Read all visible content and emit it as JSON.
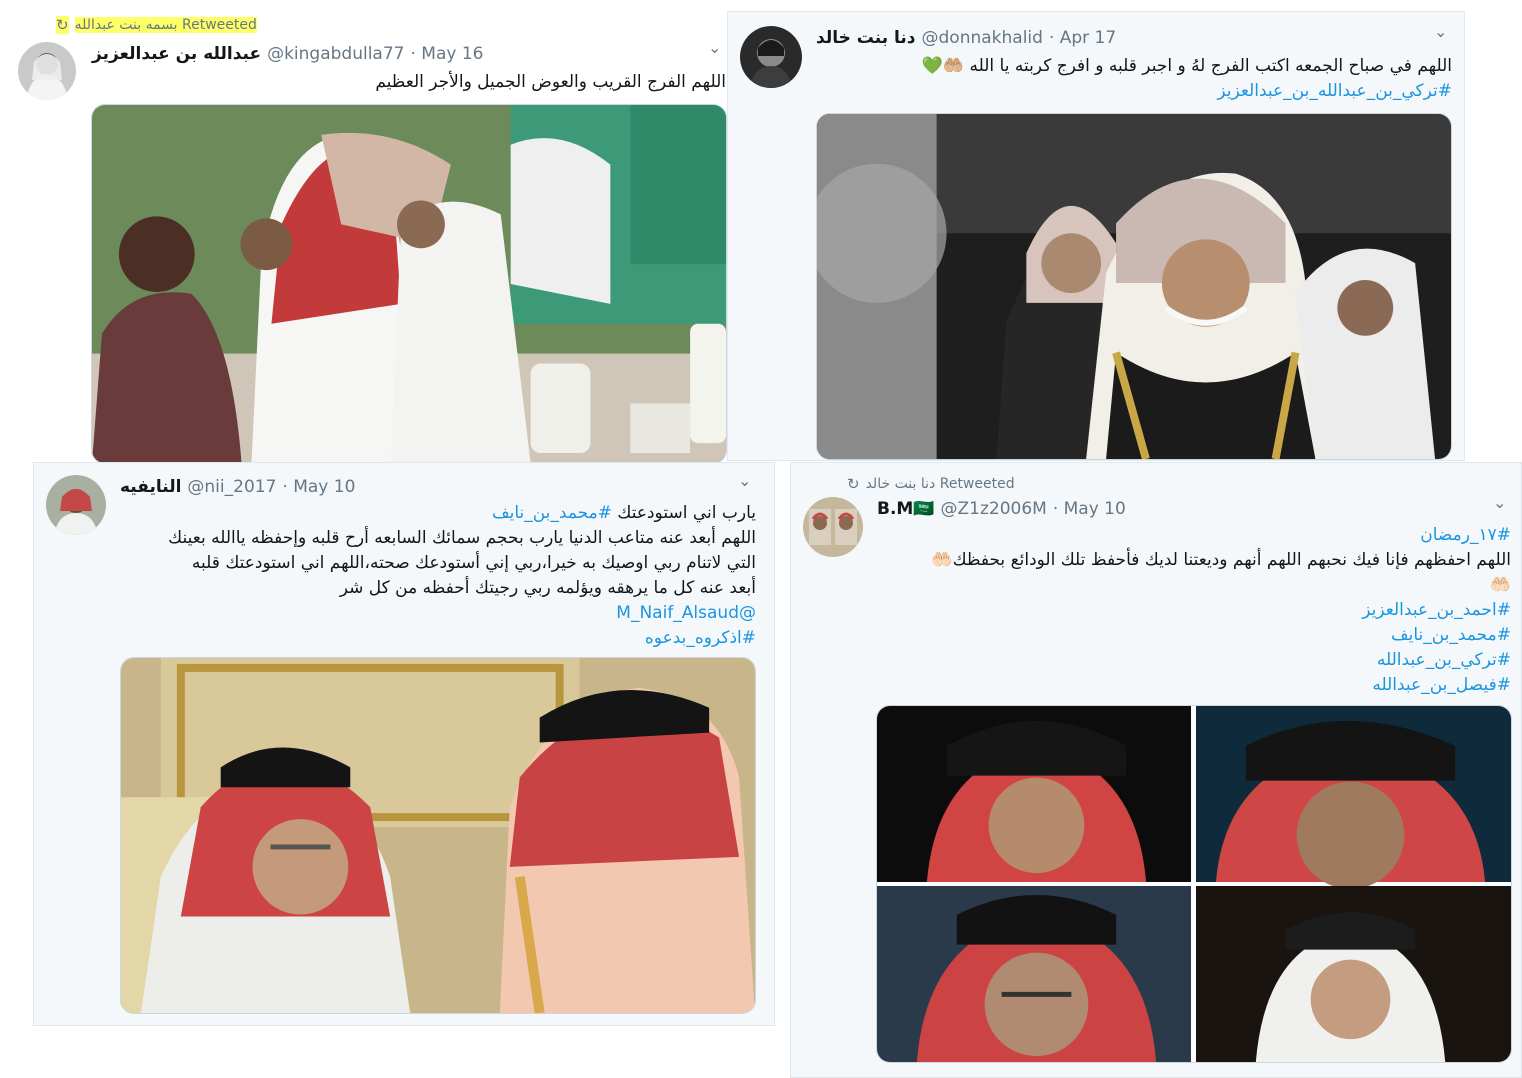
{
  "tweet1": {
    "retweet_context": "بسمه بنت عبدالله Retweeted",
    "name": "عبدالله بن عبدالعزيز",
    "handle": "@kingabdulla77",
    "date": "· May 16",
    "text": "اللهم الفرج القريب والعوض الجميل والأجر العظيم"
  },
  "tweet2": {
    "name": "دنا بنت خالد",
    "handle": "@donnakhalid",
    "date": "· Apr 17",
    "text": "اللهم في صباح الجمعه اكتب الفرج لهُ و اجبر قلبه و افرج كربته يا الله 🤲🏼💚",
    "hashtag": "#تركي_بن_عبدالله_بن_عبدالعزيز"
  },
  "tweet3": {
    "name": "النايفيه",
    "handle": "@nii_2017",
    "date": "· May 10",
    "line1": "يارب اني استودعتك",
    "line1_tag": "#محمد_بن_نايف",
    "line2": " اللهم أبعد عنه متاعب الدنيا يارب بحجم سمائك السابعه أرح قلبه وإحفظه ياالله بعينك",
    "line3": "التي لاتنام ربي اوصيك به خيرا،ربي إني أستودعك صحته،اللهم اني استودعتك قلبه",
    "line4": "أبعد عنه كل ما يرهقه ويؤلمه ربي رجيتك أحفظه من كل شر",
    "mention": "@M_Naif_Alsaud",
    "hashtag": "#اذكروه_بدعوه"
  },
  "tweet4": {
    "retweet_context": "دنا بنت خالد Retweeted",
    "name": "B.M🇸🇦",
    "handle": "@Z1z2006M",
    "date": "· May 10",
    "tag1": "#١٧_رمضان",
    "text": "اللهم احفظهم فإنا فيك نحبهم اللهم أنهم وديعتنا لديك فأحفظ تلك الودائع بحفظك🤲🏻",
    "text2": "🤲🏻",
    "tag2": "#احمد_بن_عبدالعزيز",
    "tag3": "#محمد_بن_نايف",
    "tag4": "#تركي_بن_عبدالله",
    "tag5": "#فيصل_بن_عبدالله"
  },
  "icons": {
    "retweet": "↻",
    "chevron": "⌄"
  },
  "colors": {
    "link": "#1b95e0",
    "meta": "#657786",
    "highlight": "#ffff66"
  }
}
